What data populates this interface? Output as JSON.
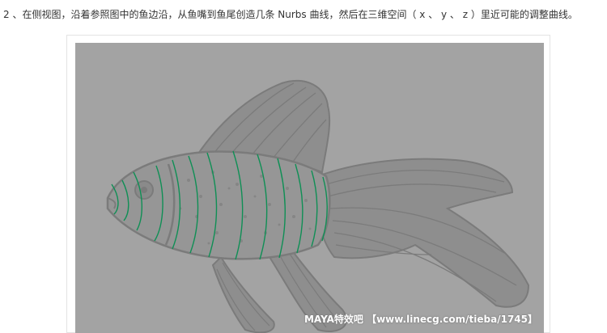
{
  "instruction": {
    "text": "2 、在侧视图，沿着参照图中的鱼边沿，从鱼嘴到鱼尾创造几条 Nurbs 曲线，然后在三维空间（ x 、 y 、 z ）里近可能的调整曲线。"
  },
  "figure": {
    "watermark": "MAYA特效吧 【www.linecg.com/tieba/1745】",
    "subject_icon": "goldfish-reference-image",
    "colors": {
      "viewport_bg": "#a3a3a3",
      "fish_fill": "#8e8e8e",
      "fish_line": "#7b7b7b",
      "curve_color": "#0f8f55"
    }
  }
}
